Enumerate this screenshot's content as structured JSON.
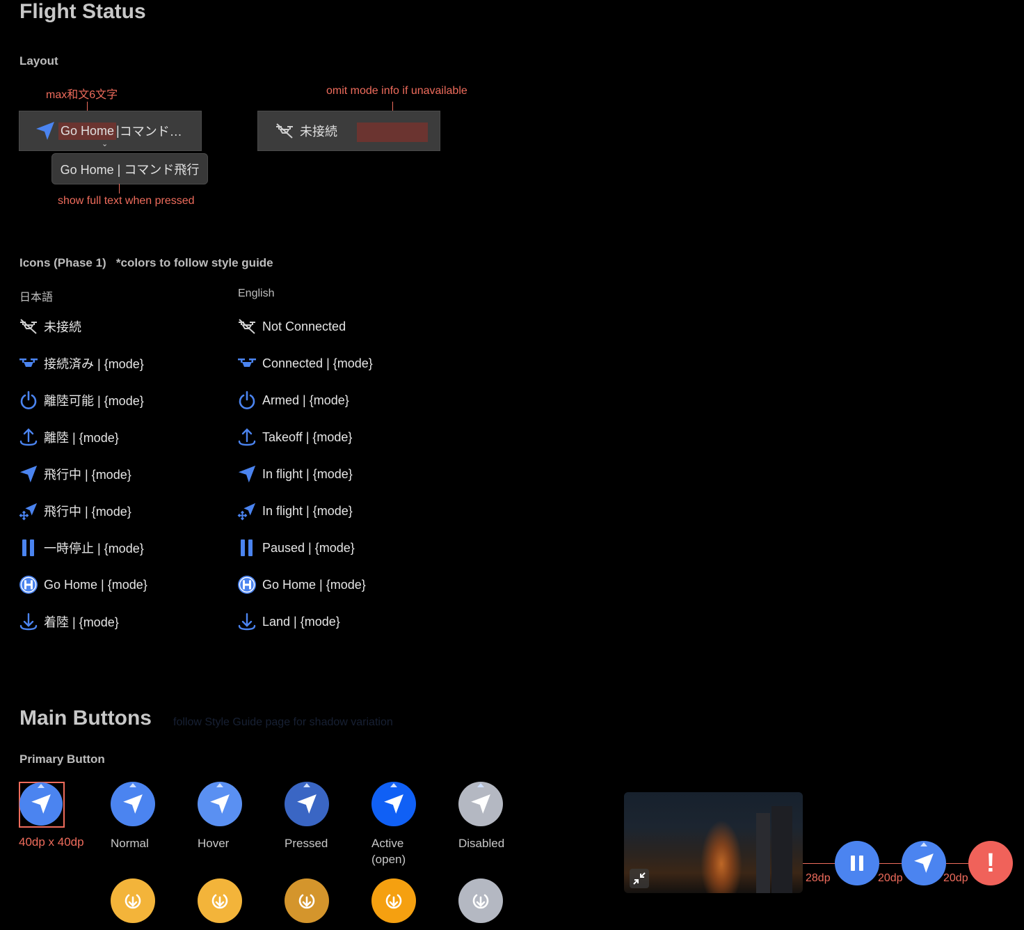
{
  "flight_status": {
    "title": "Flight Status",
    "layout_heading": "Layout",
    "annotation_max": "max和文6文字",
    "annotation_omit": "omit mode info if unavailable",
    "annotation_full": "show full text when pressed",
    "chip1": {
      "name": "Go Home",
      "sep": " | ",
      "mode": "コマンド…"
    },
    "chip1_expanded": "Go Home | コマンド飛行",
    "chip2": {
      "name": "未接続"
    }
  },
  "icons": {
    "heading": "Icons (Phase 1)   *colors to follow style guide",
    "col_ja": "日本語",
    "col_en": "English",
    "ja": [
      {
        "icon": "drone-off-icon",
        "label": "未接続"
      },
      {
        "icon": "drone-icon",
        "label": "接続済み | {mode}"
      },
      {
        "icon": "power-icon",
        "label": "離陸可能 | {mode}"
      },
      {
        "icon": "takeoff-icon",
        "label": "離陸 | {mode}"
      },
      {
        "icon": "navigation-arrow-icon",
        "label": "飛行中 | {mode}"
      },
      {
        "icon": "navigation-move-icon",
        "label": "飛行中 | {mode}"
      },
      {
        "icon": "pause-icon",
        "label": "一時停止 | {mode}"
      },
      {
        "icon": "helipad-h-icon",
        "label": "Go Home | {mode}"
      },
      {
        "icon": "land-icon",
        "label": "着陸 | {mode}"
      }
    ],
    "en": [
      {
        "icon": "drone-off-icon",
        "label": "Not Connected"
      },
      {
        "icon": "drone-icon",
        "label": "Connected | {mode}"
      },
      {
        "icon": "power-icon",
        "label": "Armed | {mode}"
      },
      {
        "icon": "takeoff-icon",
        "label": "Takeoff | {mode}"
      },
      {
        "icon": "navigation-arrow-icon",
        "label": "In flight | {mode}"
      },
      {
        "icon": "navigation-move-icon",
        "label": "In flight | {mode}"
      },
      {
        "icon": "pause-icon",
        "label": "Paused | {mode}"
      },
      {
        "icon": "helipad-h-icon",
        "label": "Go Home | {mode}"
      },
      {
        "icon": "land-icon",
        "label": "Land | {mode}"
      }
    ]
  },
  "main_buttons": {
    "title": "Main Buttons",
    "note": "follow Style Guide page for shadow variation",
    "primary_heading": "Primary Button",
    "size_label": "40dp x 40dp",
    "states": [
      "Normal",
      "Hover",
      "Pressed",
      "Active\n(open)",
      "Disabled"
    ],
    "spacing": [
      "28dp",
      "20dp",
      "20dp"
    ],
    "colors": {
      "normal": "#4b84f0",
      "hover": "#5a90f2",
      "pressed": "#3a66c4",
      "active": "#1060f5",
      "disabled": "#b4b8c2",
      "orange_normal": "#f3b43a",
      "orange_pressed": "#d4952c",
      "orange_active": "#f5a010",
      "alert": "#f0625a"
    }
  }
}
